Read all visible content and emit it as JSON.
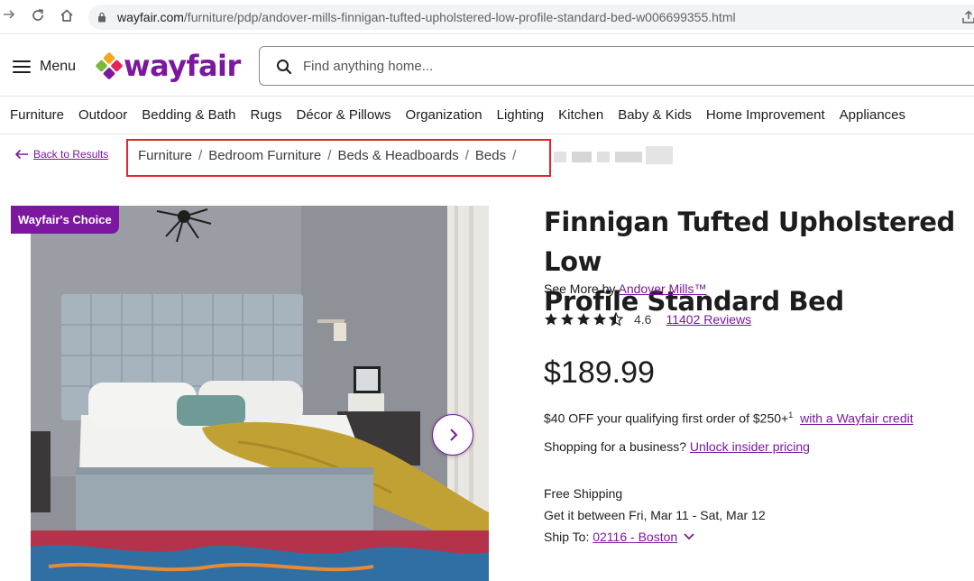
{
  "browser": {
    "url_host": "wayfair.com",
    "url_path": "/furniture/pdp/andover-mills-finnigan-tufted-upholstered-low-profile-standard-bed-w006699355.html"
  },
  "header": {
    "menu_label": "Menu",
    "logo_text": "wayfair",
    "search_placeholder": "Find anything home..."
  },
  "categories": [
    "Furniture",
    "Outdoor",
    "Bedding & Bath",
    "Rugs",
    "Décor & Pillows",
    "Organization",
    "Lighting",
    "Kitchen",
    "Baby & Kids",
    "Home Improvement",
    "Appliances"
  ],
  "breadcrumb": {
    "back_label": "Back to Results",
    "items": [
      "Furniture",
      "Bedroom Furniture",
      "Beds & Headboards",
      "Beds"
    ],
    "separator": "/"
  },
  "gallery": {
    "badge": "Wayfair's Choice"
  },
  "product": {
    "title_line1": "Finnigan Tufted Upholstered Low",
    "title_line2": "Profile Standard Bed",
    "see_more_prefix": "See More by",
    "brand": "Andover Mills™",
    "rating": 4.6,
    "rating_text": "4.6",
    "reviews_link": "11402 Reviews",
    "price": "$189.99",
    "promo_text": "$40 OFF your qualifying first order of $250+",
    "promo_sup": "1",
    "promo_link": "with a Wayfair credit",
    "business_prefix": "Shopping for a business?",
    "business_link": "Unlock insider pricing",
    "shipping_label": "Free Shipping",
    "delivery": "Get it between Fri, Mar 11 - Sat, Mar 12",
    "ship_to_prefix": "Ship To:",
    "ship_to_link": "02116 - Boston"
  },
  "colors": {
    "brand_purple": "#7b189f",
    "highlight_red": "#e5242a"
  }
}
